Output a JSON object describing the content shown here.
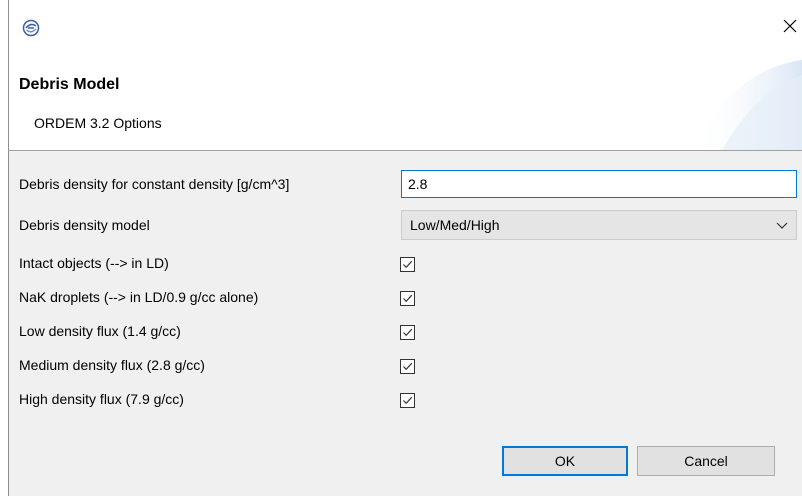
{
  "window": {
    "close_icon": "close-icon",
    "app_icon": "app-icon"
  },
  "header": {
    "title": "Debris Model",
    "subtitle": "ORDEM 3.2 Options"
  },
  "form": {
    "density_label": "Debris density for constant density [g/cm^3]",
    "density_value": "2.8",
    "model_label": "Debris density model",
    "model_selected": "Low/Med/High",
    "checkboxes": [
      {
        "label": "Intact objects (--> in LD)",
        "checked": true
      },
      {
        "label": "NaK droplets (--> in LD/0.9 g/cc alone)",
        "checked": true
      },
      {
        "label": "Low density flux (1.4 g/cc)",
        "checked": true
      },
      {
        "label": "Medium density flux (2.8 g/cc)",
        "checked": true
      },
      {
        "label": "High density flux (7.9 g/cc)",
        "checked": true
      }
    ]
  },
  "buttons": {
    "ok_label": "OK",
    "cancel_label": "Cancel"
  },
  "colors": {
    "accent": "#0078d7",
    "body_bg": "#f0f0f0"
  }
}
